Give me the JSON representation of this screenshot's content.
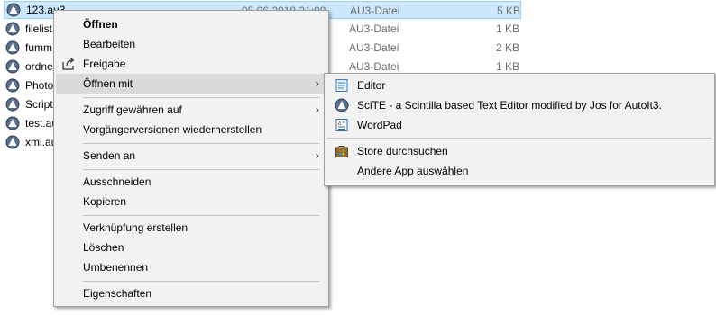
{
  "files": [
    {
      "name": "123.au3",
      "date": "05.06.2018 21:08",
      "type": "AU3-Datei",
      "size": "5 KB",
      "selected": true
    },
    {
      "name": "filelist",
      "date": "",
      "type": "AU3-Datei",
      "size": "1 KB"
    },
    {
      "name": "fumm",
      "date": "",
      "type": "AU3-Datei",
      "size": "2 KB"
    },
    {
      "name": "ordne",
      "date": "",
      "type": "AU3-Datei",
      "size": "1 KB"
    },
    {
      "name": "Photo",
      "date": "",
      "type": "",
      "size": ""
    },
    {
      "name": "Script",
      "date": "",
      "type": "",
      "size": ""
    },
    {
      "name": "test.au",
      "date": "",
      "type": "",
      "size": ""
    },
    {
      "name": "xml.au",
      "date": "",
      "type": "",
      "size": ""
    }
  ],
  "context_menu": {
    "open": "Öffnen",
    "edit": "Bearbeiten",
    "share": "Freigabe",
    "open_with": "Öffnen mit",
    "grant_access": "Zugriff gewähren auf",
    "restore_versions": "Vorgängerversionen wiederherstellen",
    "send_to": "Senden an",
    "cut": "Ausschneiden",
    "copy": "Kopieren",
    "create_shortcut": "Verknüpfung erstellen",
    "delete": "Löschen",
    "rename": "Umbenennen",
    "properties": "Eigenschaften"
  },
  "open_with_menu": {
    "editor": "Editor",
    "scite": "SciTE - a Scintilla based Text Editor modified by Jos for AutoIt3.",
    "wordpad": "WordPad",
    "store": "Store durchsuchen",
    "other_app": "Andere App auswählen"
  },
  "colors": {
    "selection_bg": "#cce8ff",
    "menu_bg": "#f2f2f2",
    "menu_hover": "#dadada"
  }
}
